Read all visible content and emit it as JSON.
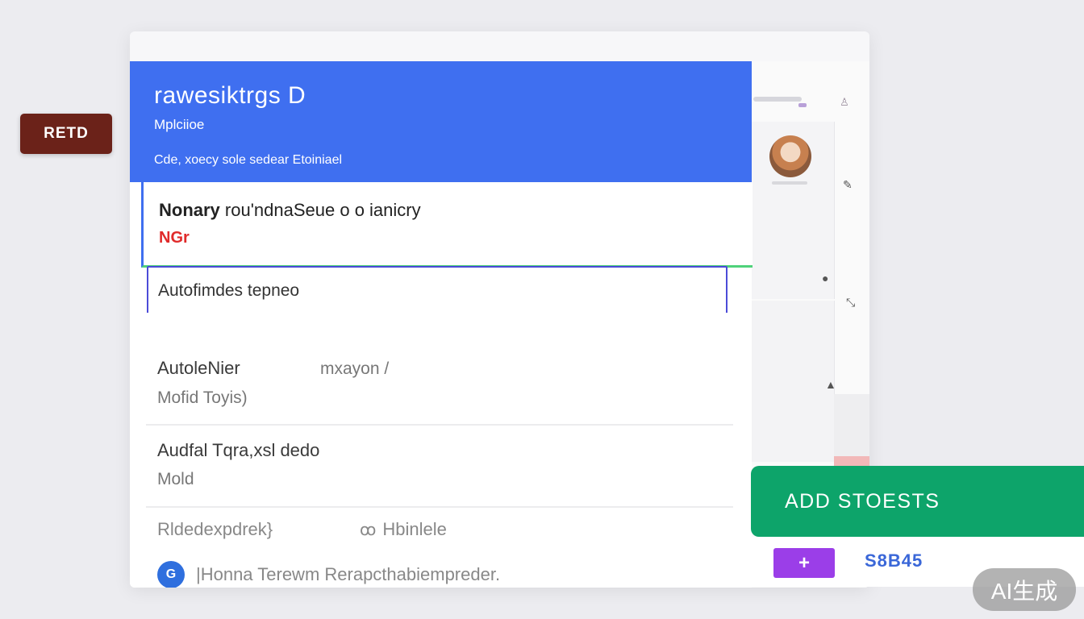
{
  "side_badge": {
    "label": "RETD"
  },
  "header": {
    "title": "rawesiktrgs D",
    "subtitle": "Mplciioe",
    "description": "Cde, xoecy sole sedear Etoiniael"
  },
  "notification": {
    "bold": "Nonary",
    "text": " rou'ndnaSeue o o      ianicry",
    "tag": "NGr"
  },
  "input": {
    "value": "Autofimdes tepneo"
  },
  "list": [
    {
      "title": "AutoleNier",
      "side": "mxayon /",
      "sub": "Mofid Toyis)"
    },
    {
      "title": "Audfal Tqra,xsl dedo",
      "sub": "Mold"
    }
  ],
  "footer": {
    "row1_text": "Rldedexpdrek}",
    "row1_side": "Hbinlele",
    "row2_globe": "G",
    "row2_text": "|Honna  Terewm Rerapcthabiempreder."
  },
  "actions": {
    "add_label": "ADD STOESTS",
    "plus_label": "+",
    "count_label": "S8B45"
  },
  "watermark": "AI生成",
  "colors": {
    "header": "#3f6ff0",
    "add_button": "#0da46a",
    "plus_button": "#9b3ee8",
    "badge": "#6b2219",
    "tag_red": "#e02a2a"
  }
}
